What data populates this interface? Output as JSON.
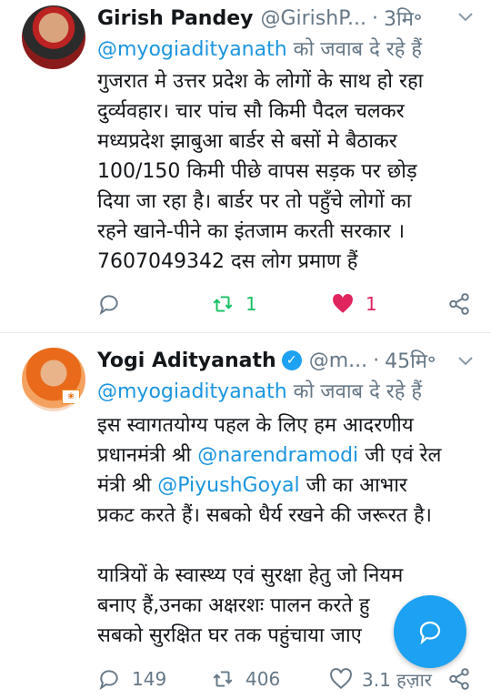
{
  "tweets": [
    {
      "author_name": "Girish Pandey",
      "author_handle": "@GirishP...",
      "time": "3मि॰",
      "replying_label": "को जवाब दे रहे हैं",
      "replying_to": "@myogiadityanath",
      "lines": [
        "गुजरात मे उत्तर प्रदेश के लोगों के साथ हो रहा",
        "दुर्व्यवहार। चार पांच सौ किमी पैदल चलकर",
        "मध्यप्रदेश झाबुआ बार्डर से बसों मे बैठाकर",
        "100/150 किमी पीछे वापस सड़क पर छोड़",
        "दिया जा रहा है। बार्डर पर तो पहुँचे लोगों का",
        "रहने खाने-पीने का इंतजाम करती सरकार ।",
        "7607049342 दस लोग प्रमाण हैं"
      ],
      "replies": "",
      "retweets": "1",
      "likes": "1",
      "liked": true
    },
    {
      "author_name": "Yogi Adityanath",
      "author_handle": "@m...",
      "time": "45मि॰",
      "verified": true,
      "replying_label": "को जवाब दे रहे हैं",
      "replying_to": "@myogiadityanath",
      "line1": "इस स्वागतयोग्य पहल के लिए हम आदरणीय",
      "line2_pre": "प्रधानमंत्री श्री ",
      "line2_mention": "@narendramodi",
      "line2_post": " जी एवं रेल",
      "line3_pre": "मंत्री श्री ",
      "line3_mention": "@PiyushGoyal",
      "line3_post": " जी का आभार",
      "line4": "प्रकट करते हैं। सबको धैर्य रखने की जरूरत है।",
      "line6": "यात्रियों के स्वास्थ्य एवं सुरक्षा हेतु जो नियम",
      "line7": "बनाए हैं,उनका अक्षरशः पालन करते हु",
      "line8": "सबको सुरक्षित घर तक पहुंचाया जाए",
      "replies": "149",
      "retweets": "406",
      "likes": "3.1 हज़ार",
      "liked": false
    }
  ],
  "colors": {
    "text": "#14171a",
    "secondary": "#657786",
    "link": "#1b95e0",
    "retweet_green": "#17bf63",
    "like_red": "#e0245e",
    "fab_blue": "#1da1f2"
  },
  "icons": [
    "chevron-down-icon",
    "reply-icon",
    "retweet-icon",
    "like-icon",
    "share-icon",
    "verified-icon",
    "compose-icon"
  ]
}
